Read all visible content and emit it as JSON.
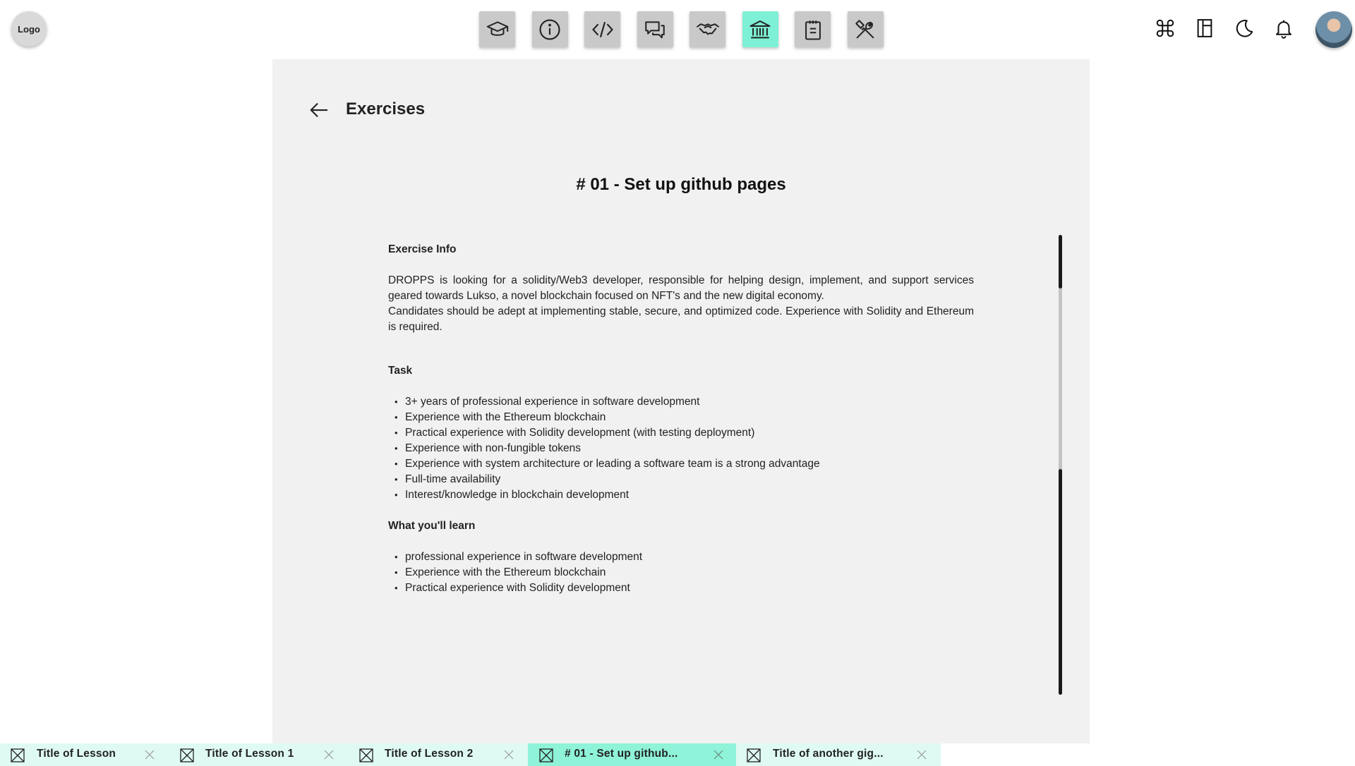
{
  "header": {
    "logo_label": "Logo",
    "nav": [
      {
        "icon": "graduation-cap-icon",
        "active": false
      },
      {
        "icon": "info-icon",
        "active": false
      },
      {
        "icon": "code-icon",
        "active": false
      },
      {
        "icon": "chat-icon",
        "active": false
      },
      {
        "icon": "handshake-icon",
        "active": false
      },
      {
        "icon": "bank-icon",
        "active": true
      },
      {
        "icon": "clipboard-icon",
        "active": false
      },
      {
        "icon": "tools-icon",
        "active": false
      }
    ],
    "utilities": [
      "command-icon",
      "layout-icon",
      "moon-icon",
      "bell-icon"
    ],
    "active_color": "#7ef0d5"
  },
  "page": {
    "section_title": "Exercises",
    "exercise_title": "# 01 - Set up github pages",
    "info_heading": "Exercise Info",
    "info_paragraphs": [
      "DROPPS is looking for a solidity/Web3 developer, responsible for helping design, implement, and support services geared towards Lukso, a novel blockchain focused on NFT's and the new digital economy.",
      "Candidates should be adept at implementing stable, secure, and optimized code. Experience with Solidity and Ethereum is required."
    ],
    "task_heading": "Task",
    "task_items": [
      "3+ years of professional experience in software development",
      "Experience with the Ethereum blockchain",
      "Practical experience with Solidity development (with testing deployment)",
      "Experience with non-fungible tokens",
      "Experience with system architecture or leading a software team is a strong advantage",
      "Full-time availability",
      "Interest/knowledge in blockchain development"
    ],
    "learn_heading": "What you'll learn",
    "learn_items": [
      "professional experience in software development",
      "Experience with the Ethereum blockchain",
      "Practical experience with Solidity development"
    ]
  },
  "tabs": [
    {
      "label": "Title of Lesson",
      "active": false
    },
    {
      "label": "Title of Lesson 1",
      "active": false
    },
    {
      "label": "Title of Lesson 2",
      "active": false
    },
    {
      "label": "# 01 - Set up github...",
      "active": true
    },
    {
      "label": "Title of another gig...",
      "active": false
    }
  ]
}
